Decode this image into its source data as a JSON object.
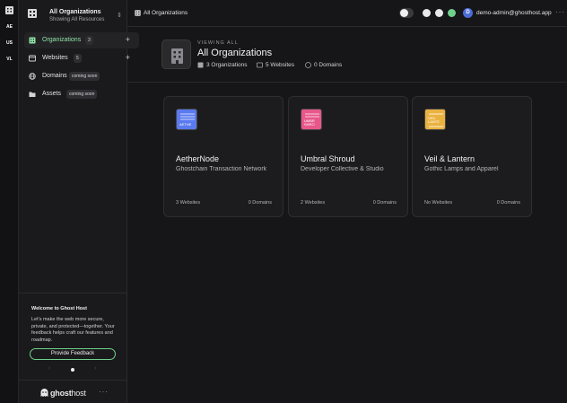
{
  "colors": {
    "accent": "#6fd08c",
    "background": "#161618",
    "sidebar": "#1a1a1c",
    "card": "#1c1c1e",
    "org_ae": "#4b6bd6",
    "org_us": "#e0507a",
    "org_vl": "#e8a93a"
  },
  "rail": {
    "orgs": [
      {
        "label": "AE",
        "color": "#4b6bd6"
      },
      {
        "label": "US",
        "color": "#e0507a"
      },
      {
        "label": "VL",
        "color": "#e8a93a"
      }
    ]
  },
  "switcher": {
    "title": "All Organizations",
    "subtitle": "Showing All Resources"
  },
  "nav": {
    "organizations": {
      "label": "Organizations",
      "badge": "3"
    },
    "websites": {
      "label": "Websites",
      "badge": "5"
    },
    "domains": {
      "label": "Domains",
      "badge": "coming soon"
    },
    "assets": {
      "label": "Assets",
      "badge": "coming soon"
    }
  },
  "welcome": {
    "title": "Welcome to Ghost Host",
    "text": "Let's make the web more secure, private, and protected—together. Your feedback helps craft our features and roadmap.",
    "button": "Provide Feedback"
  },
  "footer": {
    "logo_bold": "ghost",
    "logo_light": "host"
  },
  "topbar": {
    "breadcrumb": "All Organizations",
    "avatar": "D",
    "user": "demo-admin@ghosthost.app",
    "icons": [
      "theme-toggle-icon",
      "help-icon",
      "chat-icon",
      "notifications-icon"
    ]
  },
  "hero": {
    "eyebrow": "VIEWING ALL",
    "title": "All Organizations",
    "stats": {
      "orgs": "3 Organizations",
      "websites": "5 Websites",
      "domains": "0 Domains"
    }
  },
  "cards": [
    {
      "name": "AetherNode",
      "subtitle": "Ghostchain Transaction Network",
      "websites": "3 Websites",
      "domains": "0 Domains",
      "thumb_text": "AETHE",
      "thumb_color": "#5a7af0"
    },
    {
      "name": "Umbral Shroud",
      "subtitle": "Developer Collective & Studio",
      "websites": "2 Websites",
      "domains": "0 Domains",
      "thumb_text": "UMBR SHRO",
      "thumb_color": "#e8578a"
    },
    {
      "name": "Veil & Lantern",
      "subtitle": "Gothic Lamps and Apparel",
      "websites": "No Websites",
      "domains": "0 Domains",
      "thumb_text": "VEIL LANTE",
      "thumb_color": "#eab23f"
    }
  ]
}
